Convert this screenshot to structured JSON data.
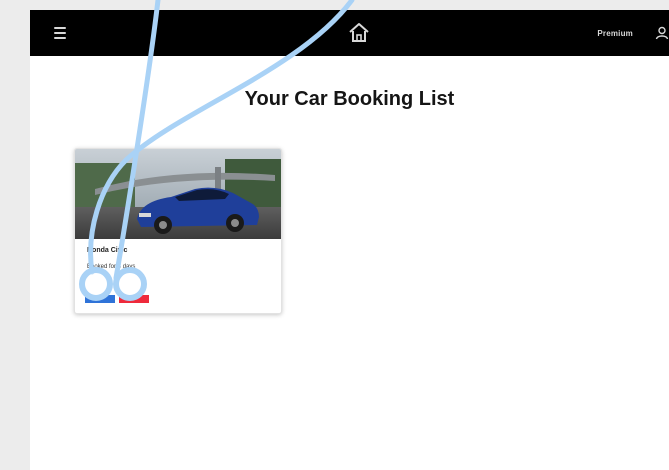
{
  "nav": {
    "premium_label": "Premium",
    "icons": [
      "menu-icon",
      "home-icon",
      "user-icon"
    ]
  },
  "main": {
    "title": "Your Car Booking List"
  },
  "bookings": [
    {
      "car_name": "Honda Civic",
      "duration": "Booked for 3 days",
      "edit_label": "",
      "cancel_label": ""
    }
  ],
  "colors": {
    "topbar": "#000000",
    "page_bg": "#ffffff",
    "edit_button": "#2f73d8",
    "cancel_button": "#ee2a3c",
    "cursor_trail": "#a9d2f6"
  }
}
